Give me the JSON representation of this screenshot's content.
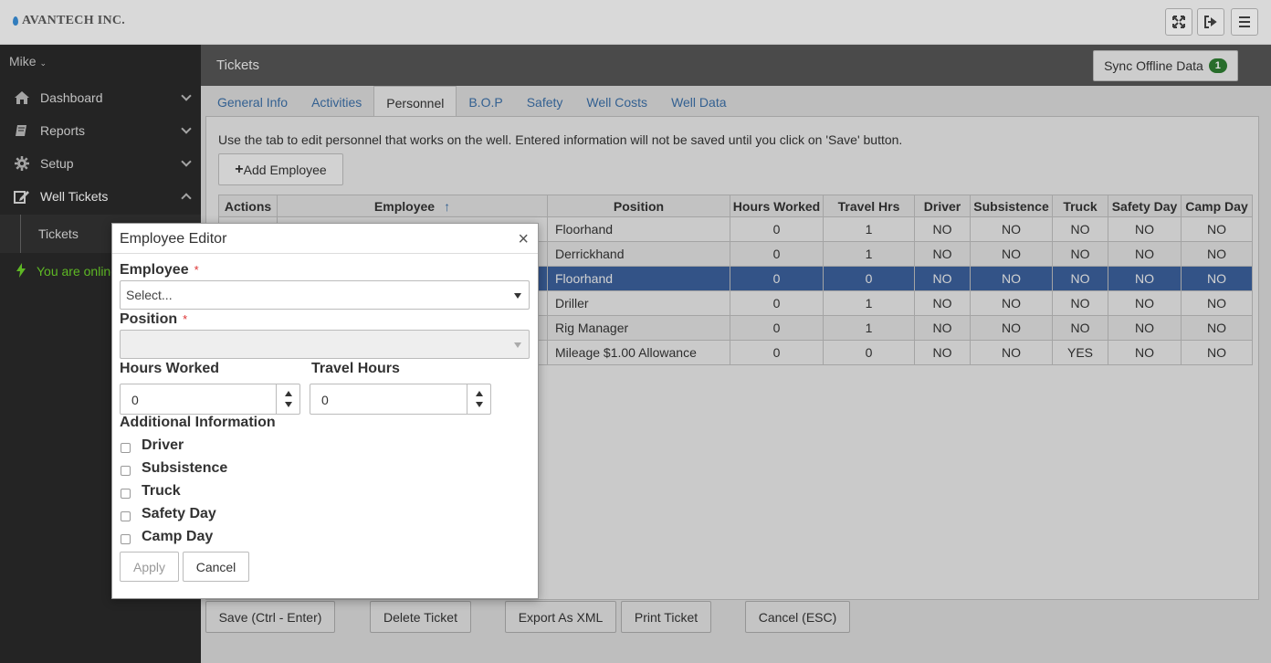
{
  "app": {
    "brand": "AVANTECH INC."
  },
  "topbar": {
    "fullscreen_icon": "fullscreen-icon",
    "logout_icon": "logout-icon",
    "menu_icon": "hamburger-icon"
  },
  "sidebar": {
    "user": "Mike",
    "items": [
      {
        "label": "Dashboard",
        "icon": "home-icon"
      },
      {
        "label": "Reports",
        "icon": "book-icon"
      },
      {
        "label": "Setup",
        "icon": "gear-icon"
      },
      {
        "label": "Well Tickets",
        "icon": "edit-icon"
      }
    ],
    "subitem": "Tickets",
    "status": "You are online"
  },
  "header": {
    "title": "Tickets",
    "sync_label": "Sync Offline Data",
    "sync_count": "1"
  },
  "tabs": [
    {
      "label": "General Info"
    },
    {
      "label": "Activities"
    },
    {
      "label": "Personnel"
    },
    {
      "label": "B.O.P"
    },
    {
      "label": "Safety"
    },
    {
      "label": "Well Costs"
    },
    {
      "label": "Well Data"
    }
  ],
  "panel": {
    "hint": "Use the tab to edit personnel that works on the well. Entered information will not be saved until you click on 'Save' button.",
    "add_label": "Add Employee"
  },
  "table": {
    "columns": [
      "Actions",
      "Employee",
      "Position",
      "Hours Worked",
      "Travel Hrs",
      "Driver",
      "Subsistence",
      "Truck",
      "Safety Day",
      "Camp Day"
    ],
    "rows": [
      {
        "position": "Floorhand",
        "hours": "0",
        "travel": "1",
        "driver": "NO",
        "subsistence": "NO",
        "truck": "NO",
        "safety": "NO",
        "camp": "NO"
      },
      {
        "position": "Derrickhand",
        "hours": "0",
        "travel": "1",
        "driver": "NO",
        "subsistence": "NO",
        "truck": "NO",
        "safety": "NO",
        "camp": "NO"
      },
      {
        "position": "Floorhand",
        "hours": "0",
        "travel": "0",
        "driver": "NO",
        "subsistence": "NO",
        "truck": "NO",
        "safety": "NO",
        "camp": "NO"
      },
      {
        "position": "Driller",
        "hours": "0",
        "travel": "1",
        "driver": "NO",
        "subsistence": "NO",
        "truck": "NO",
        "safety": "NO",
        "camp": "NO"
      },
      {
        "position": "Rig Manager",
        "hours": "0",
        "travel": "1",
        "driver": "NO",
        "subsistence": "NO",
        "truck": "NO",
        "safety": "NO",
        "camp": "NO"
      },
      {
        "position": "Mileage $1.00 Allowance",
        "hours": "0",
        "travel": "0",
        "driver": "NO",
        "subsistence": "NO",
        "truck": "YES",
        "safety": "NO",
        "camp": "NO"
      }
    ]
  },
  "footer": {
    "save": "Save (Ctrl - Enter)",
    "delete": "Delete Ticket",
    "export": "Export As XML",
    "print": "Print Ticket",
    "cancel": "Cancel (ESC)"
  },
  "dialog": {
    "title": "Employee Editor",
    "close": "×",
    "employee_label": "Employee",
    "employee_value": "Select...",
    "position_label": "Position",
    "position_value": "",
    "hours_label": "Hours Worked",
    "hours_value": "0",
    "travel_label": "Travel Hours",
    "travel_value": "0",
    "additional_label": "Additional Information",
    "checkboxes": [
      "Driver",
      "Subsistence",
      "Truck",
      "Safety Day",
      "Camp Day"
    ],
    "apply": "Apply",
    "cancel": "Cancel",
    "required_mark": "*"
  }
}
